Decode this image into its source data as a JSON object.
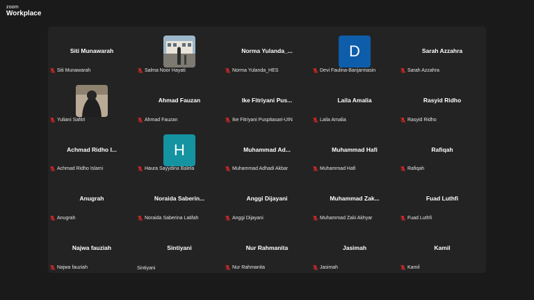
{
  "app": {
    "brand_small": "zoom",
    "brand_big": "Workplace"
  },
  "colors": {
    "background": "#1a1a1a",
    "grid_bg": "#232323",
    "muted_mic": "#e02828",
    "avatar_d": "#0e5dab",
    "avatar_h": "#1593a1"
  },
  "participants": [
    {
      "display": "Siti Munawarah",
      "label": "Siti Munawarah",
      "muted": true
    },
    {
      "display": "",
      "label": "Salma Noor Hayati",
      "muted": true,
      "avatar": "photo-building"
    },
    {
      "display": "Norma Yulanda_...",
      "label": "Norma Yulanda_HES",
      "muted": true
    },
    {
      "display": "",
      "label": "Devi Faulina-Banjarmasin",
      "muted": true,
      "avatar_letter": "D",
      "avatar_color": "#0e5dab"
    },
    {
      "display": "Sarah Azzahra",
      "label": "Sarah Azzahra",
      "muted": true
    },
    {
      "display": "",
      "label": "Yuliani Safitri",
      "muted": true,
      "avatar": "photo-person"
    },
    {
      "display": "Ahmad Fauzan",
      "label": "Ahmad Fauzan",
      "muted": true
    },
    {
      "display": "Ike Fitriyani Pus...",
      "label": "Ike Fitriyani Puspitasari-UIN",
      "muted": true
    },
    {
      "display": "Laila Amalia",
      "label": "Laila Amalia",
      "muted": true
    },
    {
      "display": "Rasyid Ridho",
      "label": "Rasyid Ridho",
      "muted": true
    },
    {
      "display": "Achmad Ridho I...",
      "label": "Achmad Ridho Islami",
      "muted": true
    },
    {
      "display": "",
      "label": "Haura Sayydina Balela",
      "muted": true,
      "avatar_letter": "H",
      "avatar_color": "#1593a1"
    },
    {
      "display": "Muhammad Ad...",
      "label": "Muhammad Adhadi Akbar",
      "muted": true
    },
    {
      "display": "Muhammad Hafi",
      "label": "Muhammad Hafi",
      "muted": true
    },
    {
      "display": "Rafiqah",
      "label": "Rafiqah",
      "muted": true
    },
    {
      "display": "Anugrah",
      "label": "Anugrah",
      "muted": true
    },
    {
      "display": "Noraida Saberin...",
      "label": "Noraida Saberina Latifah",
      "muted": true
    },
    {
      "display": "Anggi Dijayani",
      "label": "Anggi Dijayani",
      "muted": true
    },
    {
      "display": "Muhammad Zak...",
      "label": "Muhammad Zaki Akhyar",
      "muted": true
    },
    {
      "display": "Fuad Luthfi",
      "label": "Fuad Luthfi",
      "muted": true
    },
    {
      "display": "Najwa fauziah",
      "label": "Najwa fauziah",
      "muted": true
    },
    {
      "display": "Sintiyani",
      "label": "Sintiyani",
      "muted": false
    },
    {
      "display": "Nur Rahmanita",
      "label": "Nur Rahmanita",
      "muted": true
    },
    {
      "display": "Jasimah",
      "label": "Jasimah",
      "muted": true
    },
    {
      "display": "Kamil",
      "label": "Kamil",
      "muted": true
    }
  ]
}
